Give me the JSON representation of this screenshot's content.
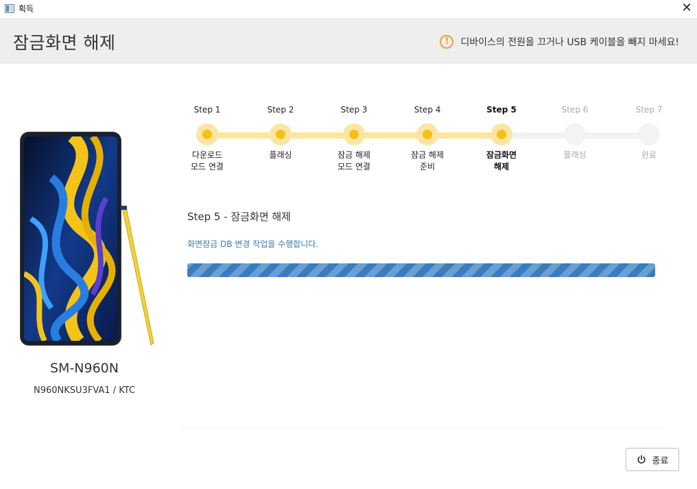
{
  "window": {
    "title": "획득",
    "close_glyph": "✕"
  },
  "header": {
    "title": "잠금화면 해제",
    "warning_icon": "!",
    "warning": "디바이스의 전원을 끄거나 USB 케이블을 빼지 마세요!",
    "accent_color": "#f0a02a"
  },
  "device": {
    "model": "SM-N960N",
    "firmware": "N960NKSU3FVA1 / KTC"
  },
  "steps": [
    {
      "label": "Step 1",
      "desc": "다운로드\n모드 연결",
      "state": "done"
    },
    {
      "label": "Step 2",
      "desc": "플래싱",
      "state": "done"
    },
    {
      "label": "Step 3",
      "desc": "잠금 해제\n모드 연결",
      "state": "done"
    },
    {
      "label": "Step 4",
      "desc": "잠금 해제\n준비",
      "state": "done"
    },
    {
      "label": "Step 5",
      "desc": "잠금화면\n해제",
      "state": "current"
    },
    {
      "label": "Step 6",
      "desc": "플래싱",
      "state": "future"
    },
    {
      "label": "Step 7",
      "desc": "완료",
      "state": "future"
    }
  ],
  "content": {
    "heading": "Step 5 - 잠금화면 해제",
    "status": "화면잠금 DB 변경 작업을 수행합니다.",
    "progress_state": "indeterminate"
  },
  "footer": {
    "exit_label": "종료",
    "exit_icon": "power-icon"
  },
  "colors": {
    "step_active": "#f6c114",
    "step_active_ring": "#fce5a3",
    "progress": "#3a7dbc",
    "status_text": "#3d78b0"
  }
}
